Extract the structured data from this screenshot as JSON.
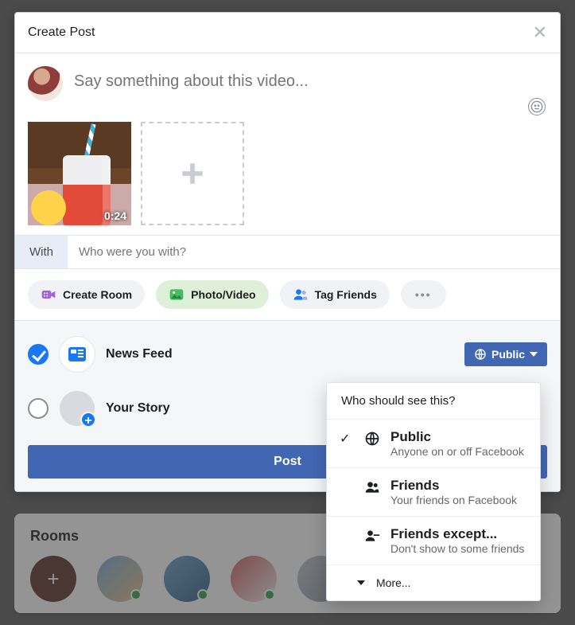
{
  "modal": {
    "title": "Create Post",
    "composer_placeholder": "Say something about this video...",
    "video_duration": "0:24",
    "with_label": "With",
    "with_placeholder": "Who were you with?",
    "chips": {
      "create_room": "Create Room",
      "photo_video": "Photo/Video",
      "tag_friends": "Tag Friends"
    },
    "destinations": {
      "news_feed": "News Feed",
      "your_story": "Your Story"
    },
    "privacy_button": "Public",
    "post_button": "Post"
  },
  "privacy_dropdown": {
    "heading": "Who should see this?",
    "options": [
      {
        "title": "Public",
        "subtitle": "Anyone on or off Facebook",
        "selected": true
      },
      {
        "title": "Friends",
        "subtitle": "Your friends on Facebook",
        "selected": false
      },
      {
        "title": "Friends except...",
        "subtitle": "Don't show to some friends",
        "selected": false
      }
    ],
    "more": "More..."
  },
  "rooms": {
    "title": "Rooms"
  }
}
